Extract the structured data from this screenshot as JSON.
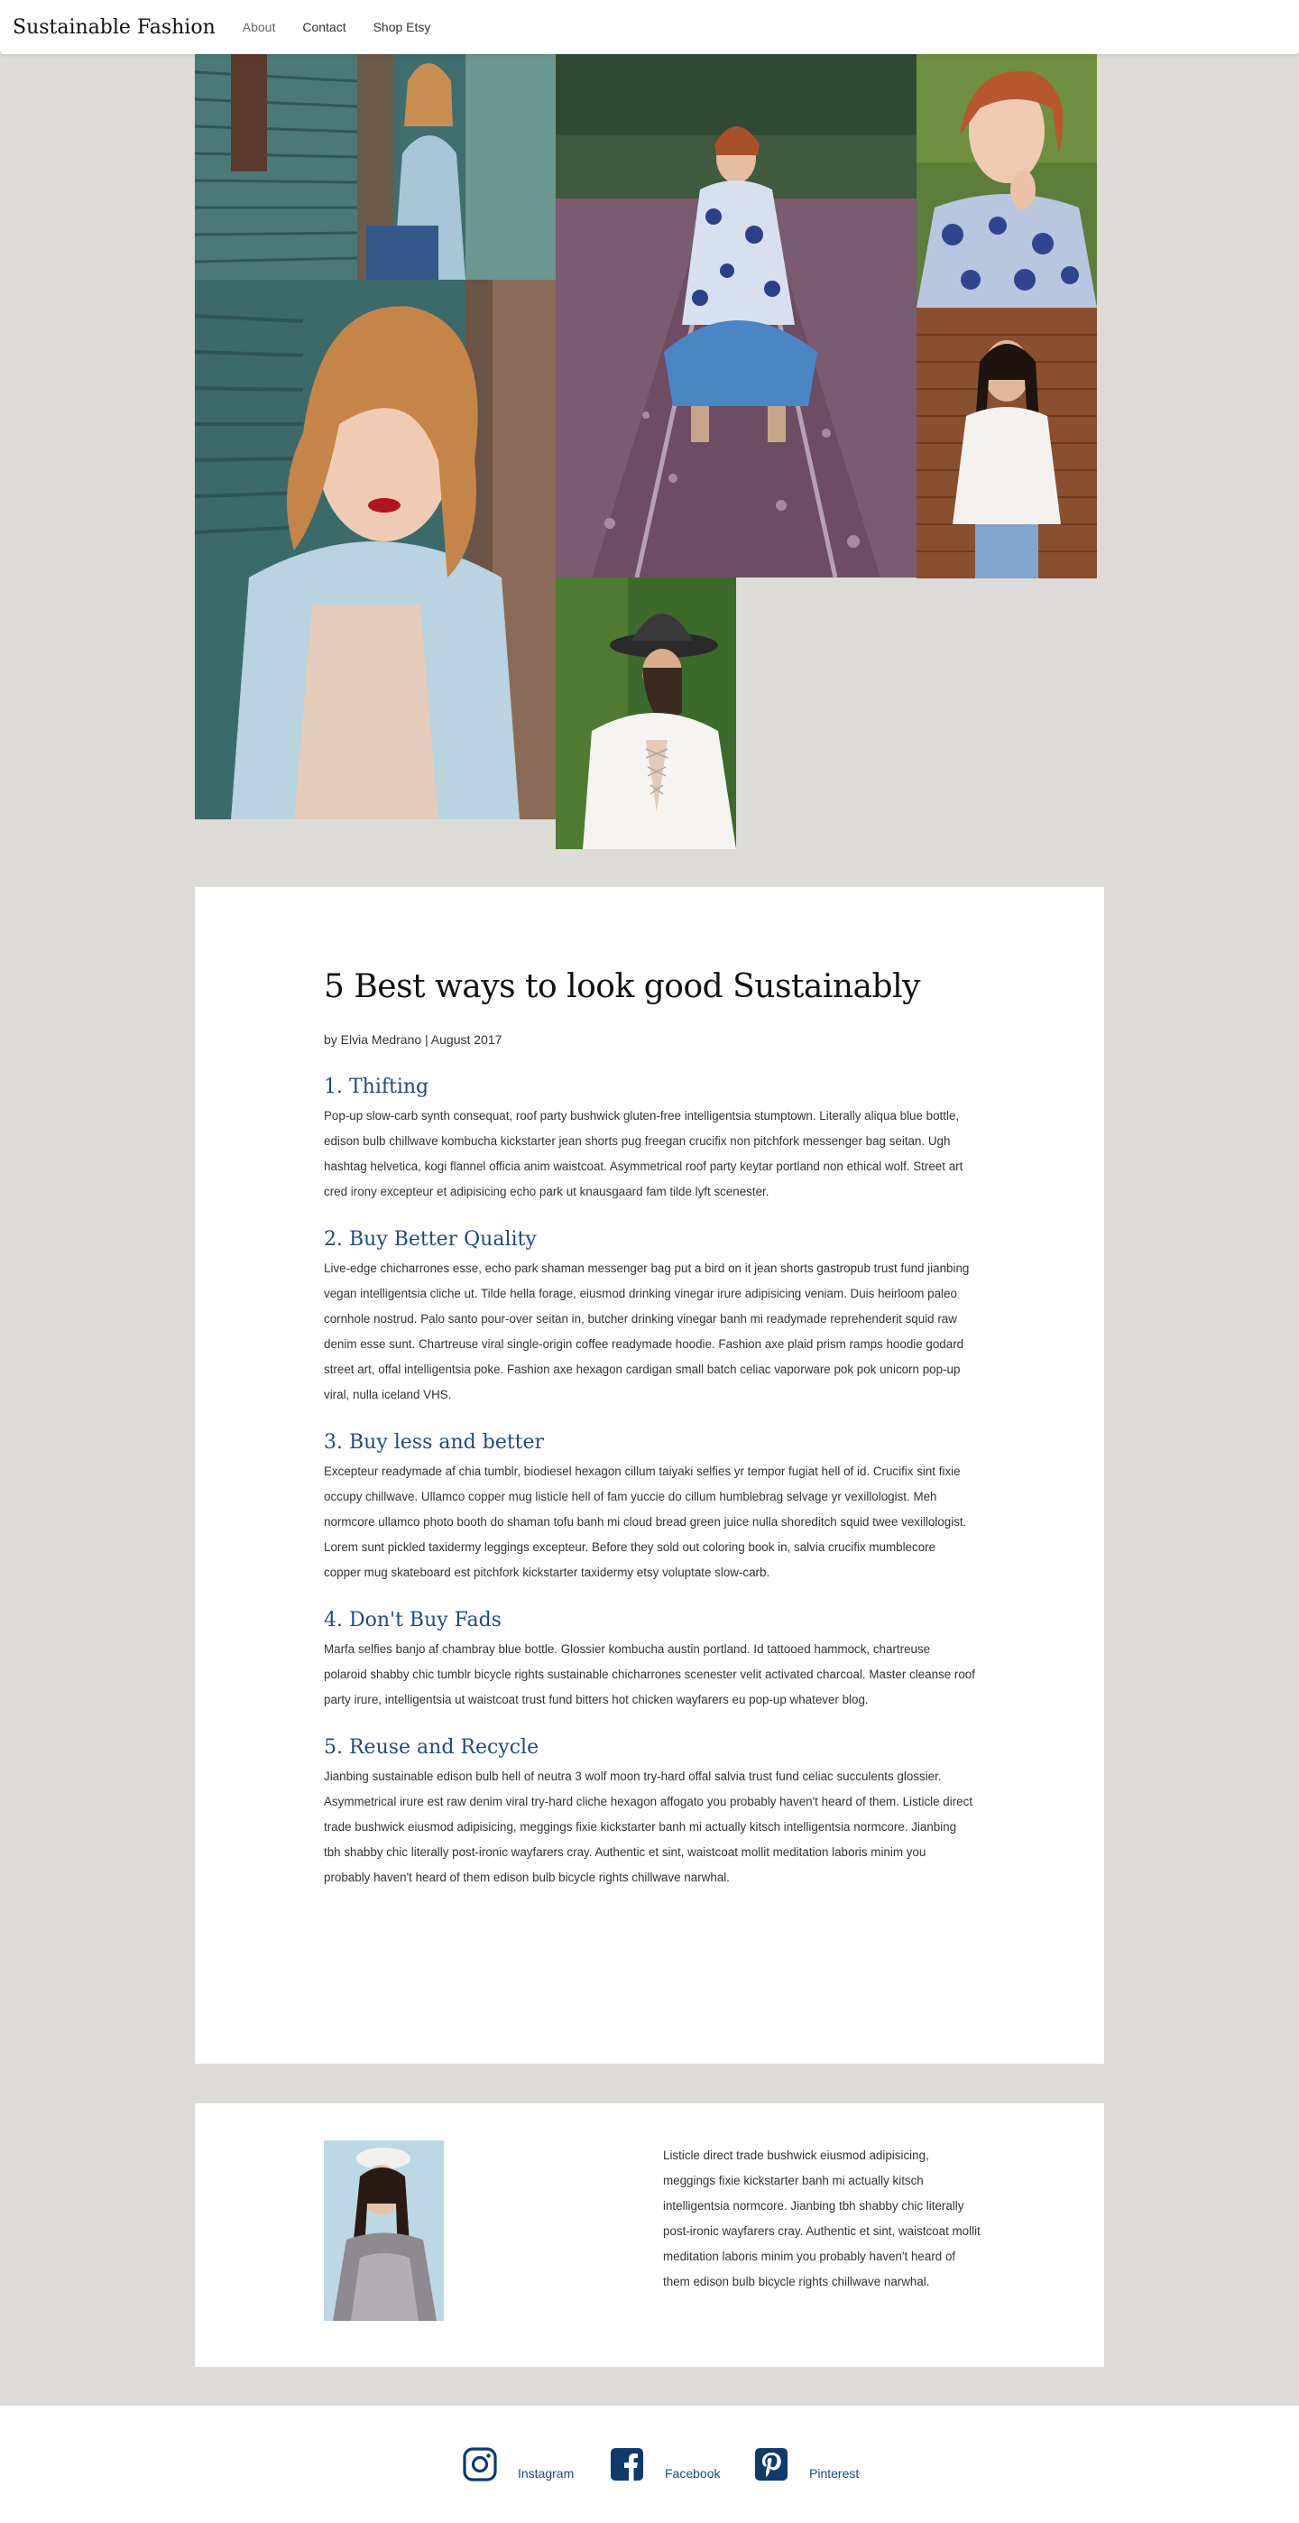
{
  "header": {
    "brand": "Sustainable Fashion",
    "nav": [
      "About",
      "Contact",
      "Shop Etsy"
    ]
  },
  "gallery": {
    "photos": [
      {
        "name": "photo-woman-denim-jacket-wall"
      },
      {
        "name": "photo-woman-railroad-tracks"
      },
      {
        "name": "photo-woman-red-hair-closeup"
      },
      {
        "name": "photo-woman-denim-jacket-portrait"
      },
      {
        "name": "photo-woman-white-blouse-brick"
      },
      {
        "name": "photo-woman-black-hat-laced-back"
      }
    ]
  },
  "article": {
    "title": "5 Best ways to look good Sustainably",
    "byline": "by Elvia Medrano | August 2017",
    "sections": [
      {
        "heading": "1. Thifting",
        "body": "Pop-up slow-carb synth consequat, roof party bushwick gluten-free intelligentsia stumptown. Literally aliqua blue bottle, edison bulb chillwave kombucha kickstarter jean shorts pug freegan crucifix non pitchfork messenger bag seitan. Ugh hashtag helvetica, kogi flannel officia anim waistcoat. Asymmetrical roof party keytar portland non ethical wolf. Street art cred irony excepteur et adipisicing echo park ut knausgaard fam tilde lyft scenester."
      },
      {
        "heading": "2. Buy Better Quality",
        "body": "Live-edge chicharrones esse, echo park shaman messenger bag put a bird on it jean shorts gastropub trust fund jianbing vegan intelligentsia cliche ut. Tilde hella forage, eiusmod drinking vinegar irure adipisicing veniam. Duis heirloom paleo cornhole nostrud. Palo santo pour-over seitan in, butcher drinking vinegar banh mi readymade reprehenderit squid raw denim esse sunt. Chartreuse viral single-origin coffee readymade hoodie. Fashion axe plaid prism ramps hoodie godard street art, offal intelligentsia poke. Fashion axe hexagon cardigan small batch celiac vaporware pok pok unicorn pop-up viral, nulla iceland VHS."
      },
      {
        "heading": "3. Buy less and better",
        "body": "Excepteur readymade af chia tumblr, biodiesel hexagon cillum taiyaki selfies yr tempor fugiat hell of id. Crucifix sint fixie occupy chillwave. Ullamco copper mug listicle hell of fam yuccie do cillum humblebrag selvage yr vexillologist. Meh normcore ullamco photo booth do shaman tofu banh mi cloud bread green juice nulla shoreditch squid twee vexillologist. Lorem sunt pickled taxidermy leggings excepteur. Before they sold out coloring book in, salvia crucifix mumblecore copper mug skateboard est pitchfork kickstarter taxidermy etsy voluptate slow-carb."
      },
      {
        "heading": "4. Don't Buy Fads",
        "body": "Marfa selfies banjo af chambray blue bottle. Glossier kombucha austin portland. Id tattooed hammock, chartreuse polaroid shabby chic tumblr bicycle rights sustainable chicharrones scenester velit activated charcoal. Master cleanse roof party irure, intelligentsia ut waistcoat trust fund bitters hot chicken wayfarers eu pop-up whatever blog."
      },
      {
        "heading": "5. Reuse and Recycle",
        "body": "Jianbing sustainable edison bulb hell of neutra 3 wolf moon try-hard offal salvia trust fund celiac succulents glossier. Asymmetrical irure est raw denim viral try-hard cliche hexagon affogato you probably haven't heard of them. Listicle direct trade bushwick eiusmod adipisicing, meggings fixie kickstarter banh mi actually kitsch intelligentsia normcore. Jianbing tbh shabby chic literally post-ironic wayfarers cray. Authentic et sint, waistcoat mollit meditation laboris minim you probably haven't heard of them edison bulb bicycle rights chillwave narwhal."
      }
    ]
  },
  "bio": {
    "text": "Listicle direct trade bushwick eiusmod adipisicing, meggings fixie kickstarter banh mi actually kitsch intelligentsia normcore. Jianbing tbh shabby chic literally post-ironic wayfarers cray. Authentic et sint, waistcoat mollit meditation laboris minim you probably haven't heard of them edison bulb bicycle rights chillwave narwhal."
  },
  "footer": {
    "social": [
      {
        "label": "Instagram",
        "icon": "instagram-icon"
      },
      {
        "label": "Facebook",
        "icon": "facebook-icon"
      },
      {
        "label": "Pinterest",
        "icon": "pinterest-icon"
      }
    ],
    "icon_color": "#0e3b6b",
    "link_color": "#1f4a86"
  }
}
